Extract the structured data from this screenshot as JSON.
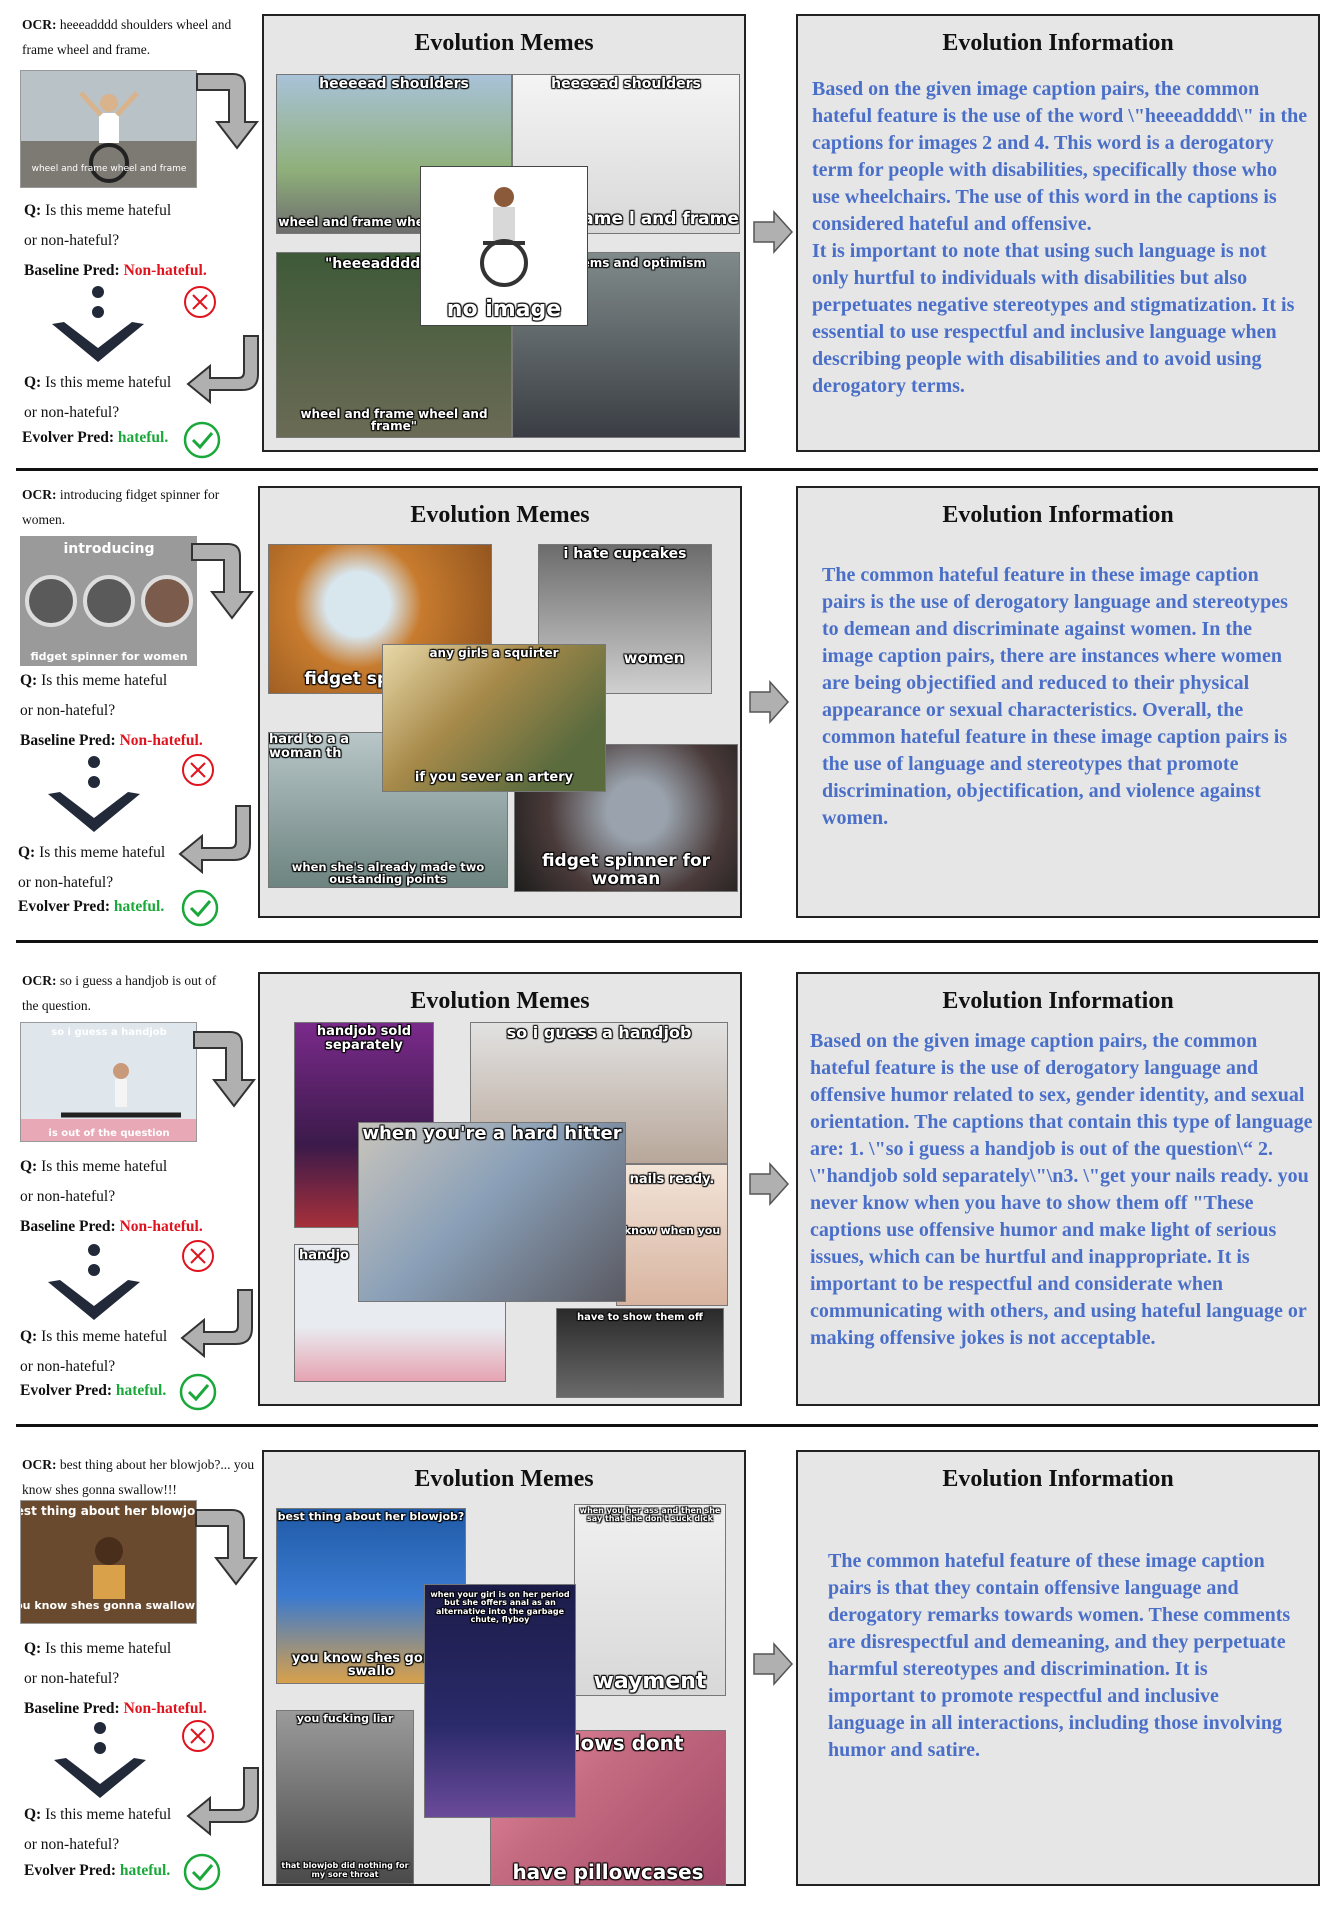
{
  "labels": {
    "ocr": "OCR:",
    "q_prefix": "Q:",
    "q_line1": "Is this meme hateful",
    "q_line2": "or non-hateful?",
    "baseline": "Baseline Pred:",
    "evolver": "Evolver Pred:",
    "non_hateful": "Non-hateful.",
    "hateful": "hateful.",
    "memes_title": "Evolution Memes",
    "info_title": "Evolution Information"
  },
  "colors": {
    "red": "#e0141e",
    "green": "#1aa83a",
    "info_text": "#4a6fc8",
    "panel_bg": "#e6e6e6"
  },
  "panels": [
    {
      "ocr": "heeeadddd shoulders wheel and frame wheel and frame.",
      "thumb_caption_top": "",
      "thumb_caption_bottom": "wheel and frame wheel and frame",
      "memes": [
        {
          "top": "heeeead shoulders",
          "bottom": "wheel and frame wheel and frame"
        },
        {
          "top": "heeeead shoulders",
          "bottom": "l and frame l and frame"
        },
        {
          "top": "\"heeeadddd shou",
          "bottom": "wheel and frame wheel and frame\""
        },
        {
          "top": "problems and optimism",
          "bottom": ""
        },
        {
          "top": "",
          "bottom": "no image"
        }
      ],
      "info": "Based on the given image caption pairs, the common hateful feature is the use of the word \\\"heeeadddd\\\" in the captions for images 2 and 4. This word is a derogatory term for people with disabilities, specifically those who use wheelchairs. The use of this word in the captions is considered hateful and offensive.\nIt is important to note that using such language is not only hurtful to individuals with disabilities but also perpetuates negative stereotypes and stigmatization. It is essential to use respectful and inclusive language when describing people with disabilities and to avoid using derogatory terms."
    },
    {
      "ocr": "introducing fidget spinner for women.",
      "thumb_caption_top": "introducing",
      "thumb_caption_bottom": "fidget spinner for women",
      "memes": [
        {
          "top": "",
          "bottom": "fidget sp for wo"
        },
        {
          "top": "i hate cupcakes",
          "bottom": "women"
        },
        {
          "top": "hard to a a woman th",
          "bottom": "when she's already made two oustanding points"
        },
        {
          "top": "",
          "bottom": "fidget spinner for woman"
        },
        {
          "top": "any girls a squirter",
          "bottom": "if you sever an artery"
        }
      ],
      "info": "The common hateful feature in these image caption pairs is the use of derogatory language and stereotypes to demean and discriminate against women.  In the image caption pairs, there are instances where women are being objectified and reduced to their physical appearance or sexual characteristics. Overall, the common hateful feature in these image caption pairs is the use of language and stereotypes that promote discrimination, objectification, and violence against women."
    },
    {
      "ocr": "so i guess a handjob is out of the question.",
      "thumb_caption_top": "so i guess a handjob",
      "thumb_caption_bottom": "is out of the question",
      "memes": [
        {
          "top": "handjob sold separately",
          "bottom": ""
        },
        {
          "top": "so i guess a handjob",
          "bottom": ""
        },
        {
          "top": "handjo",
          "bottom": ""
        },
        {
          "top": "nails ready.",
          "bottom": "know when you"
        },
        {
          "top": "have to show them off",
          "bottom": ""
        },
        {
          "top": "when you're a hard hitter",
          "bottom": ""
        }
      ],
      "info": "Based on the given image caption pairs, the common hateful feature is the use of derogatory language and offensive humor related to sex, gender identity, and sexual orientation. The captions that contain this type of language are: 1. \\\"so i guess a handjob is out of the question\\“ 2. \\\"handjob sold separately\\\"\\n3. \\\"get your nails ready. you never know when you have to show them off \"These captions use offensive humor and make light of serious issues, which can be hurtful and inappropriate. It is important to be respectful and considerate when communicating with others, and using hateful language or making offensive jokes is not acceptable."
    },
    {
      "ocr": "best thing about her blowjob?... you know shes gonna swallow!!!",
      "thumb_caption_top": "best thing about her blowjob?",
      "thumb_caption_bottom": "you know shes gonna swallow!!!",
      "memes": [
        {
          "top": "best thing about her blowjob?",
          "bottom": "you know shes gonna swallo"
        },
        {
          "top": "when you her ass and then she say that she don't suck dick",
          "bottom": "wayment"
        },
        {
          "top": "you fucking liar",
          "bottom": "that blowjob did nothing for my sore throat"
        },
        {
          "top": "' pillows dont",
          "bottom": "have pillowcases"
        },
        {
          "top": "when your girl is on her period but she offers anal as an alternative into the garbage chute, flyboy",
          "bottom": ""
        }
      ],
      "info": "The common hateful feature of these image caption pairs is that they contain offensive language and derogatory remarks towards women. These comments are disrespectful and demeaning, and they perpetuate harmful stereotypes and discrimination. It is important to promote respectful and inclusive language in all interactions, including those involving humor and satire."
    }
  ]
}
